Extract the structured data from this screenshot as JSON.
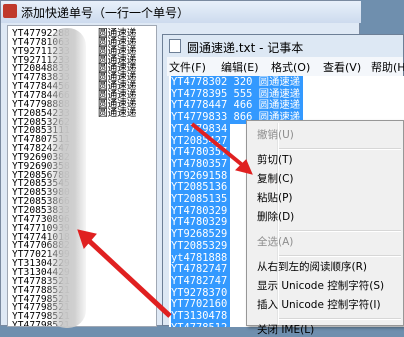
{
  "left_window": {
    "title": "添加快递单号（一行一个单号）",
    "rows": [
      "YT47792288",
      "YT47781063",
      "YT92711233",
      "YT92711233",
      "YT20848833",
      "YT47783833",
      "YT47784456",
      "YT47784466",
      "YT47798888",
      "YT20854233",
      "YT20853262",
      "YT20853111",
      "YT47807511",
      "YT47824247",
      "YT92690382",
      "YT92690358",
      "YT20856788",
      "YT20853545",
      "YT20853980",
      "YT20853866",
      "YT20853833",
      "YT47730896",
      "YT47710939",
      "YT47741018",
      "YT47706882",
      "YT77021499",
      "YT31304229",
      "YT31304429",
      "YT47783521",
      "YT47788521",
      "YT47798521",
      "YT47798521",
      "YT47798521",
      "YT47798521"
    ],
    "suffixes": [
      "圆通速递",
      "圆通速递",
      "圆通速递",
      "圆通速递",
      "圆通速递",
      "圆通速递",
      "圆通速递",
      "圆通速递",
      "圆通速递",
      "圆通速递"
    ]
  },
  "notepad": {
    "title": "圆通速递.txt - 记事本",
    "menus": [
      "文件(F)",
      "编辑(E)",
      "格式(O)",
      "查看(V)",
      "帮助(H)"
    ],
    "rows": [
      "YT4778302 320 圆通速递",
      "YT4778395 555 圆通速递",
      "YT4778447 466 圆通速递",
      "YT4779833 866 圆通速递",
      "YT4779834",
      "YT2085427",
      "YT4780357",
      "YT4780357",
      "YT9269158",
      "YT2085136",
      "YT2085135",
      "YT4780329",
      "YT4780329",
      "YT9268529",
      "YT2085329",
      "yt4781888",
      "YT4782747",
      "YT4782747",
      "YT9278370",
      "YT7702160",
      "YT3130478",
      "YT4778512"
    ]
  },
  "context_menu": {
    "items": [
      {
        "label": "撤销(U)",
        "disabled": true
      },
      {
        "sep": true
      },
      {
        "label": "剪切(T)",
        "disabled": false
      },
      {
        "label": "复制(C)",
        "disabled": false
      },
      {
        "label": "粘贴(P)",
        "disabled": false
      },
      {
        "label": "删除(D)",
        "disabled": false
      },
      {
        "sep": true
      },
      {
        "label": "全选(A)",
        "disabled": true
      },
      {
        "sep": true
      },
      {
        "label": "从右到左的阅读顺序(R)",
        "disabled": false
      },
      {
        "label": "显示 Unicode 控制字符(S)",
        "disabled": false
      },
      {
        "label": "插入 Unicode 控制字符(I)",
        "disabled": false
      },
      {
        "sep": true
      },
      {
        "label": "关闭 IME(L)",
        "disabled": false
      }
    ]
  },
  "colors": {
    "selection": "#3399ff",
    "arrow": "#e02020",
    "desktop": "#6f8fae"
  }
}
